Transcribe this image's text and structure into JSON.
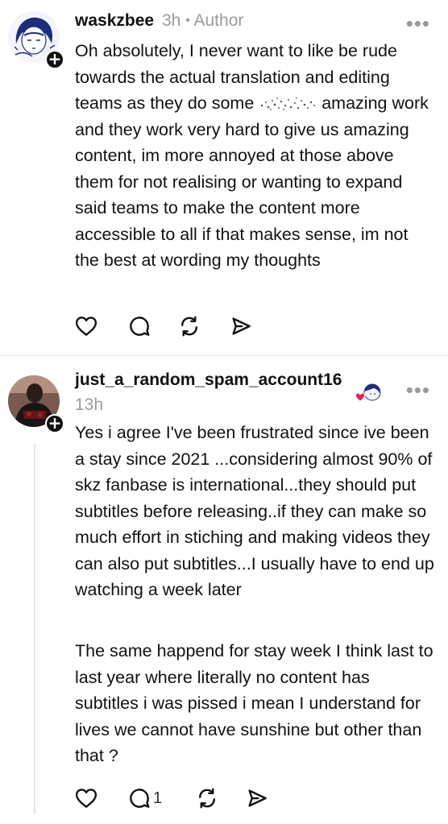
{
  "colors": {
    "text": "#111111",
    "muted": "#9a9a9a",
    "heart": "#e0245e",
    "divider": "#e8e8e8"
  },
  "post1": {
    "username": "waskzbee",
    "time": "3h",
    "separator": "•",
    "author_tag": "Author",
    "more_icon": "more-horizontal-icon",
    "text_before": "Oh absolutely, I never want to like be rude towards the actual translation and editing teams as they do some ",
    "text_after": " amazing work and they work very hard to give us amazing content, im more annoyed at those above them for not realising or wanting to expand said teams to make the content more accessible to all if that makes sense, im not the best at wording my thoughts",
    "actions": {
      "like": "heart-icon",
      "reply": "comment-icon",
      "repost": "repost-icon",
      "share": "share-icon"
    }
  },
  "post2": {
    "username": "just_a_random_spam_account16",
    "time": "13h",
    "more_icon": "more-horizontal-icon",
    "paragraph1": "Yes i agree I've been frustrated since ive been a stay since 2021 ...considering almost 90% of skz fanbase is international...they should put subtitles before releasing..if they can make so much effort in stiching and making videos they can also put subtitles...I usually have to end up watching a week later",
    "paragraph2": "The same happend for stay week I think last to last year where literally no content has subtitles i was pissed i mean I understand for lives we cannot have sunshine but other than that ?",
    "reply_count": "1",
    "actions": {
      "like": "heart-icon",
      "reply": "comment-icon",
      "repost": "repost-icon",
      "share": "share-icon"
    }
  }
}
